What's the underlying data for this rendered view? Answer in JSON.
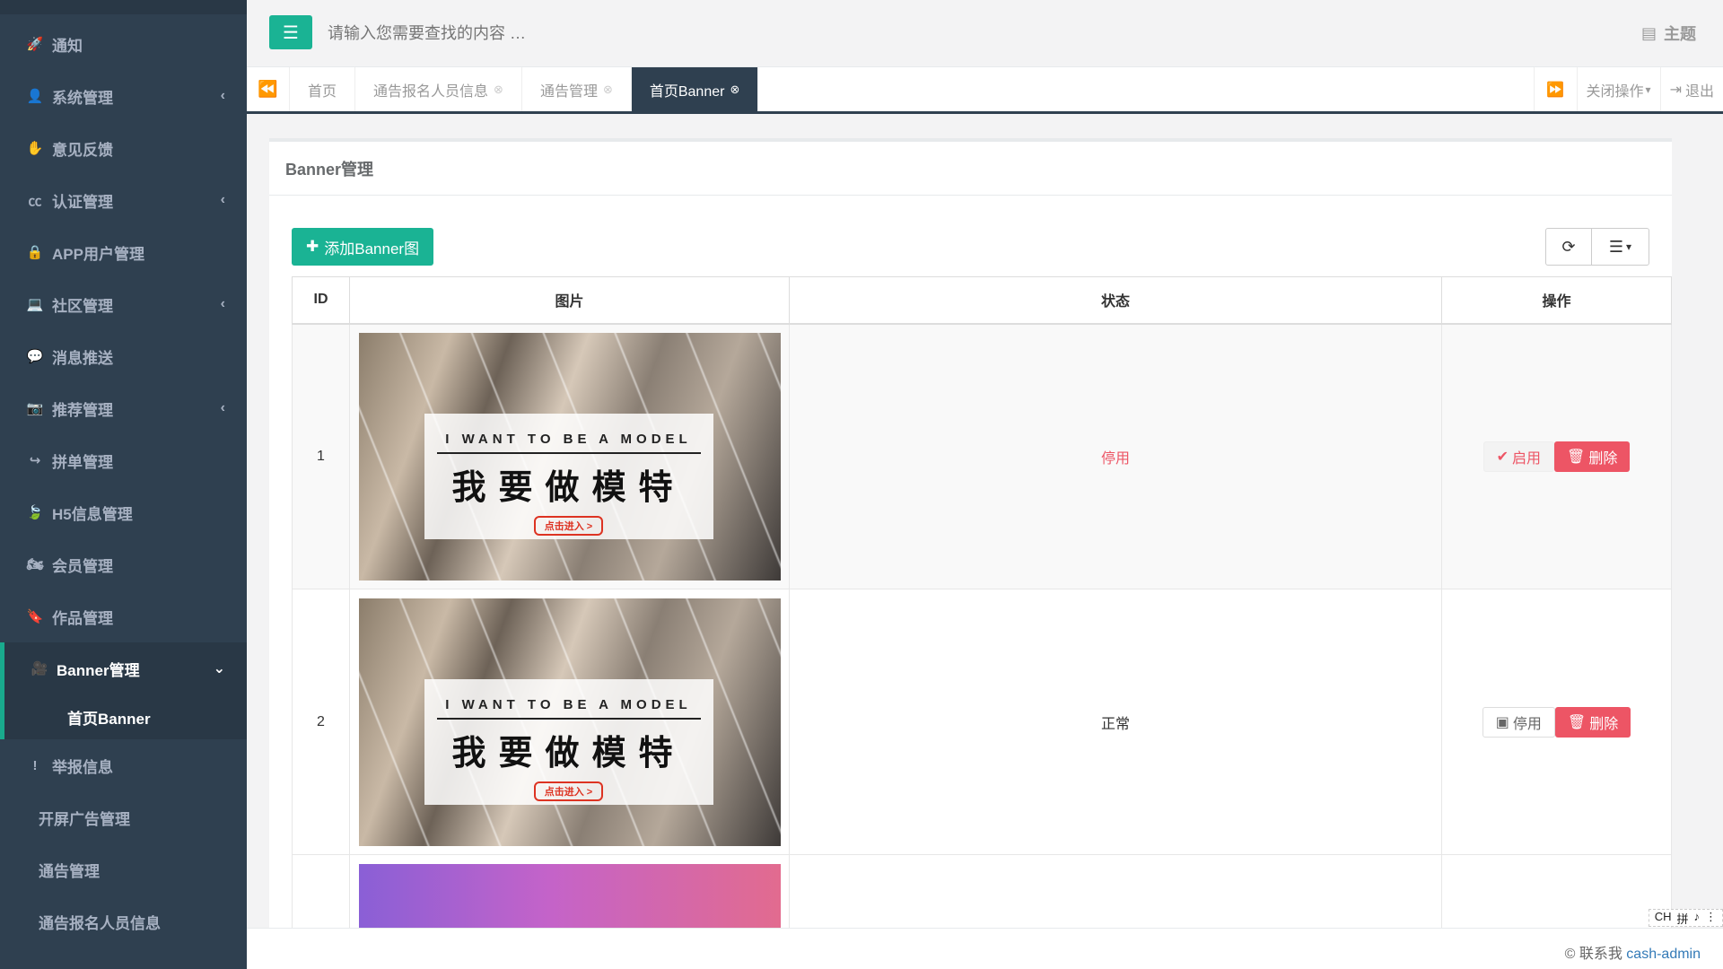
{
  "sidebar": {
    "items": [
      {
        "label": "通知",
        "icon": "rocket-icon",
        "glyph": "🚀"
      },
      {
        "label": "系统管理",
        "icon": "user-icon",
        "glyph": "👤",
        "arrow": "‹"
      },
      {
        "label": "意见反馈",
        "icon": "hand-icon",
        "glyph": "✋"
      },
      {
        "label": "认证管理",
        "icon": "cc-icon",
        "glyph": "㏄",
        "arrow": "‹"
      },
      {
        "label": "APP用户管理",
        "icon": "lock-icon",
        "glyph": "🔒"
      },
      {
        "label": "社区管理",
        "icon": "laptop-icon",
        "glyph": "💻",
        "arrow": "‹"
      },
      {
        "label": "消息推送",
        "icon": "comment-icon",
        "glyph": "💬"
      },
      {
        "label": "推荐管理",
        "icon": "camera-icon",
        "glyph": "📷",
        "arrow": "‹"
      },
      {
        "label": "拼单管理",
        "icon": "share-icon",
        "glyph": "↪"
      },
      {
        "label": "H5信息管理",
        "icon": "leaf-icon",
        "glyph": "🍃"
      },
      {
        "label": "会员管理",
        "icon": "motorcycle-icon",
        "glyph": "🏍"
      },
      {
        "label": "作品管理",
        "icon": "bookmark-icon",
        "glyph": "🔖"
      }
    ],
    "active": {
      "label": "Banner管理",
      "icon": "video-camera-icon",
      "glyph": "🎥",
      "arrow": "⌄"
    },
    "active_sub": "首页Banner",
    "after": [
      {
        "label": "举报信息",
        "icon": "exclamation-icon",
        "glyph": "!"
      }
    ],
    "plain": [
      "开屏广告管理",
      "通告管理",
      "通告报名人员信息"
    ]
  },
  "topbar": {
    "search_placeholder": "请输入您需要查找的内容 …",
    "theme_label": "主题"
  },
  "tabs": {
    "items": [
      {
        "label": "首页",
        "closable": false
      },
      {
        "label": "通告报名人员信息",
        "closable": true
      },
      {
        "label": "通告管理",
        "closable": true
      },
      {
        "label": "首页Banner",
        "closable": true,
        "active": true
      }
    ],
    "close_ops": "关闭操作",
    "logout": "退出"
  },
  "panel": {
    "title": "Banner管理",
    "add_button": "添加Banner图"
  },
  "table": {
    "headers": [
      "ID",
      "图片",
      "状态",
      "操作"
    ],
    "rows": [
      {
        "id": "1",
        "status": "停用",
        "toggle": "启用",
        "delete": "删除"
      },
      {
        "id": "2",
        "status": "正常",
        "toggle": "停用",
        "delete": "删除"
      }
    ],
    "banner": {
      "en": "I WANT TO BE A MODEL",
      "cn": "我要做模特",
      "enter": "点击进入 >"
    }
  },
  "footer": {
    "prefix": "© 联系我",
    "link": "cash-admin"
  },
  "ime": [
    "CH",
    "拼",
    "♪",
    "⋮"
  ],
  "colors": {
    "sidebar": "#2f4050",
    "accent": "#1ab394",
    "danger": "#ed5565"
  }
}
